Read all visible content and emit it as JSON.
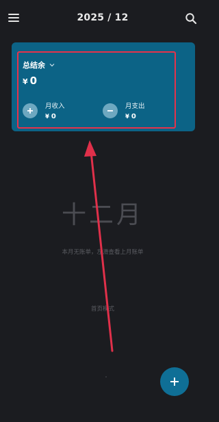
{
  "header": {
    "title": "2025 / 12"
  },
  "balance_card": {
    "title": "总结余",
    "currency": "¥",
    "balance": "0",
    "income": {
      "label": "月收入",
      "value": "0"
    },
    "expense": {
      "label": "月支出",
      "value": "0"
    }
  },
  "empty_state": {
    "month": "十二月",
    "message": "本月无账单，左滑查看上月账单",
    "mode": "首页模式"
  },
  "colors": {
    "background": "#1b1c20",
    "card": "#0c6386",
    "highlight": "#e8324a",
    "fab": "#0f6f96"
  },
  "icons": {
    "menu": "menu-icon",
    "search": "search-icon",
    "chevron": "chevron-down-icon",
    "income": "plus-icon",
    "expense": "minus-icon",
    "fab": "plus-icon"
  }
}
